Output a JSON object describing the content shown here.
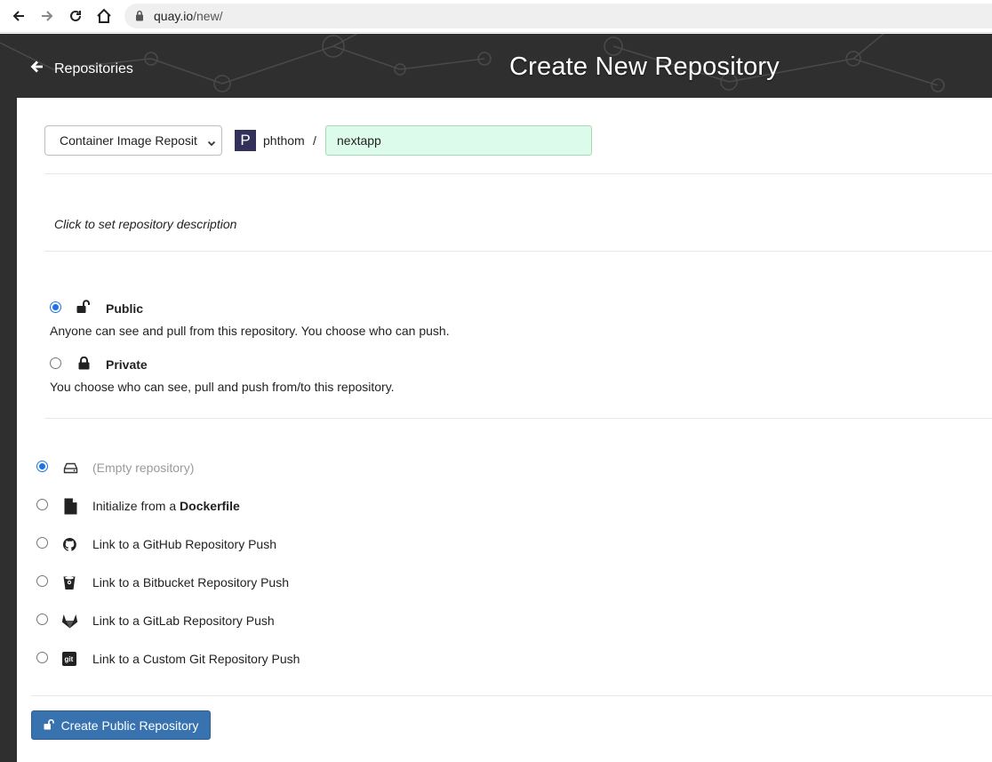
{
  "browser": {
    "url_host": "quay.io",
    "url_path": "/new/"
  },
  "header": {
    "back_label": "Repositories",
    "title": "Create New Repository"
  },
  "form": {
    "repo_type_selected": "Container Image Reposit",
    "namespace_avatar_letter": "P",
    "namespace": "phthom",
    "separator": "/",
    "repo_name_value": "nextapp",
    "description_prompt": "Click to set repository description"
  },
  "visibility": {
    "public_label": "Public",
    "public_desc": "Anyone can see and pull from this repository. You choose who can push.",
    "private_label": "Private",
    "private_desc": "You choose who can see, pull and push from/to this repository.",
    "selected": "public"
  },
  "init_options": [
    {
      "text": "(Empty repository)",
      "icon": "drive-icon"
    },
    {
      "text": "Initialize from a ",
      "bold": "Dockerfile",
      "icon": "file-icon"
    },
    {
      "text": "Link to a GitHub Repository Push",
      "icon": "github-icon"
    },
    {
      "text": "Link to a Bitbucket Repository Push",
      "icon": "bitbucket-icon"
    },
    {
      "text": "Link to a GitLab Repository Push",
      "icon": "gitlab-icon"
    },
    {
      "text": "Link to a Custom Git Repository Push",
      "icon": "git-icon"
    }
  ],
  "create_button_label": "Create Public Repository",
  "colors": {
    "header_bg": "#2f2f2f",
    "accent": "#3873b0",
    "name_input_bg": "#ddfbeb",
    "avatar_bg": "#33315a"
  }
}
